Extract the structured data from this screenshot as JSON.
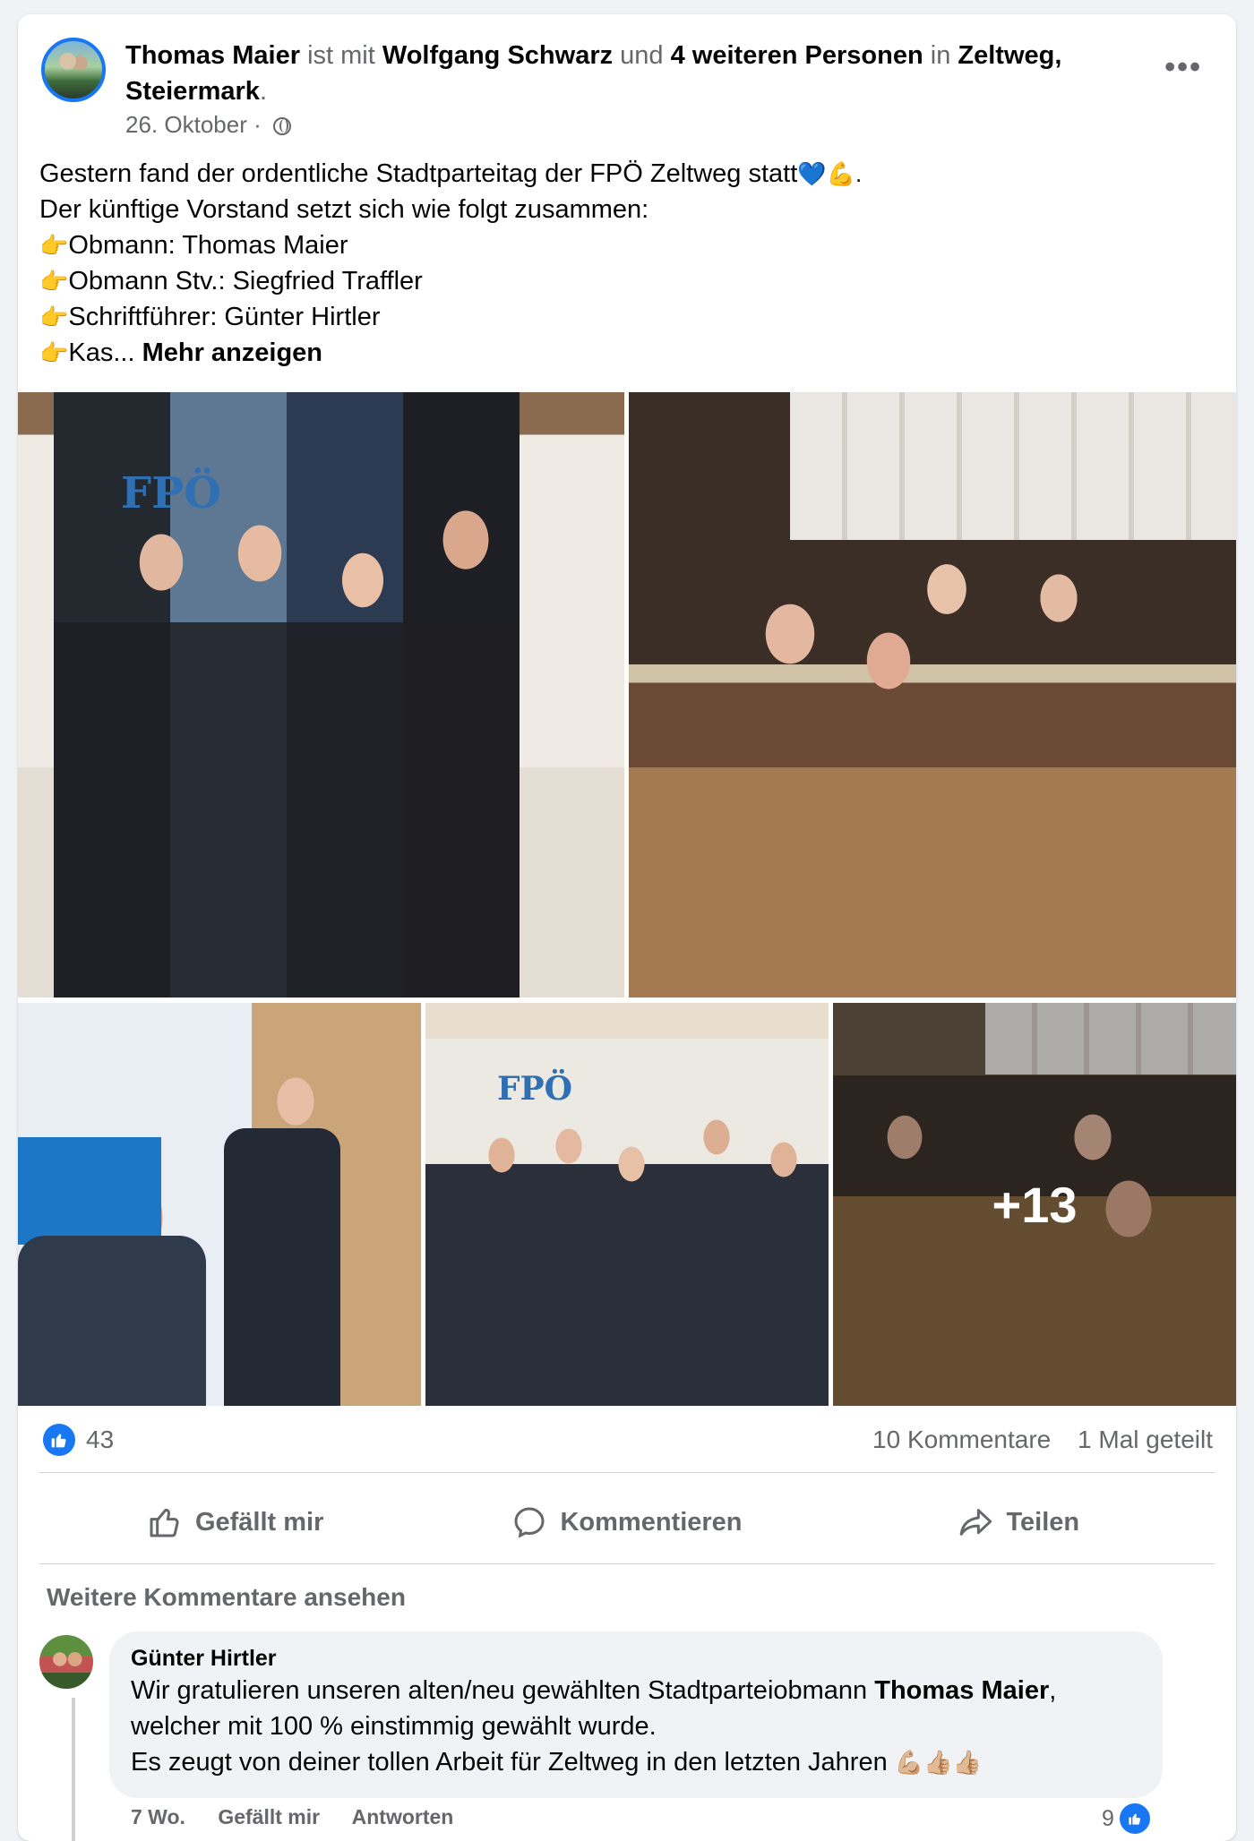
{
  "post": {
    "author": "Thomas Maier",
    "with_text": "ist mit",
    "tagged_person": "Wolfgang Schwarz",
    "and_text": "und",
    "others": "4 weiteren Personen",
    "in_text": "in",
    "location": "Zeltweg, Steiermark",
    "date": "26. Oktober",
    "separator": "·",
    "audience_icon": "globe-icon",
    "lines": [
      "Gestern fand der ordentliche Stadtparteitag der FPÖ Zeltweg statt",
      "Der künftige Vorstand setzt sich wie folgt zusammen:",
      "Obmann: Thomas Maier",
      "Obmann Stv.: Siegfried Traffler",
      "Schriftführer: Günter Hirtler",
      "Kas..."
    ],
    "emoji_line1": "💙💪.",
    "pointer_emoji": "👉",
    "see_more": "Mehr anzeigen",
    "photo_more_count": "+13",
    "photo_logo_text": "FPÖ"
  },
  "stats": {
    "reaction_count": "43",
    "comments": "10 Kommentare",
    "shares": "1 Mal geteilt"
  },
  "actions": {
    "like": "Gefällt mir",
    "comment": "Kommentieren",
    "share": "Teilen"
  },
  "comments": {
    "view_more": "Weitere Kommentare ansehen",
    "items": [
      {
        "author": "Günter Hirtler",
        "text_part1": "Wir gratulieren unseren alten/neu gewählten Stadtparteiobmann ",
        "mention": "Thomas Maier",
        "text_part2": ",",
        "line2": "welcher mit 100 % einstimmig gewählt wurde.",
        "line3": "Es zeugt von deiner tollen Arbeit für Zeltweg in den letzten Jahren ",
        "line3_emoji": "💪🏼👍🏼👍🏼",
        "time": "7 Wo.",
        "like": "Gefällt mir",
        "reply": "Antworten",
        "reactions": "9"
      }
    ]
  },
  "colors": {
    "accent": "#1877f2",
    "secondary_text": "#65676b",
    "background": "#f0f2f5"
  }
}
